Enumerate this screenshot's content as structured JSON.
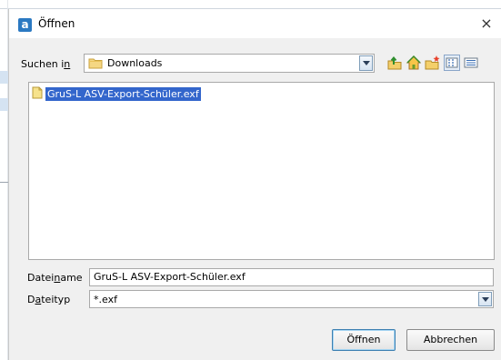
{
  "dialog": {
    "app_icon_letter": "a",
    "title": "Öffnen",
    "close_glyph": "×"
  },
  "look_in": {
    "label_pre": "Suchen i",
    "label_mnemonic": "n",
    "value": "Downloads"
  },
  "toolbar": {
    "icons": [
      "up-one-level-icon",
      "home-icon",
      "new-folder-icon",
      "list-view-icon",
      "details-view-icon"
    ]
  },
  "files": [
    {
      "name": "GruS-L ASV-Export-Schüler.exf",
      "selected": true
    }
  ],
  "file_name": {
    "label_pre": "Datei",
    "label_mnemonic": "n",
    "label_post": "ame",
    "value": "GruS-L ASV-Export-Schüler.exf"
  },
  "file_type": {
    "label_pre": "D",
    "label_mnemonic": "a",
    "label_post": "teityp",
    "value": "*.exf"
  },
  "buttons": {
    "open": "Öffnen",
    "cancel": "Abbrechen"
  },
  "colors": {
    "selection": "#3366cc",
    "accent": "#2b79c2"
  }
}
